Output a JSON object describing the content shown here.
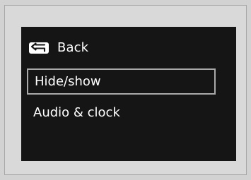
{
  "back": {
    "label": "Back",
    "icon": "back-icon"
  },
  "menu": {
    "items": [
      {
        "label": "Hide/show",
        "selected": true
      },
      {
        "label": "Audio & clock",
        "selected": false
      }
    ]
  },
  "colors": {
    "background": "#d2d2d2",
    "frame": "#d9d9d9",
    "screen": "#151515",
    "text": "#ffffff",
    "selection_border": "#a9a9a9"
  }
}
